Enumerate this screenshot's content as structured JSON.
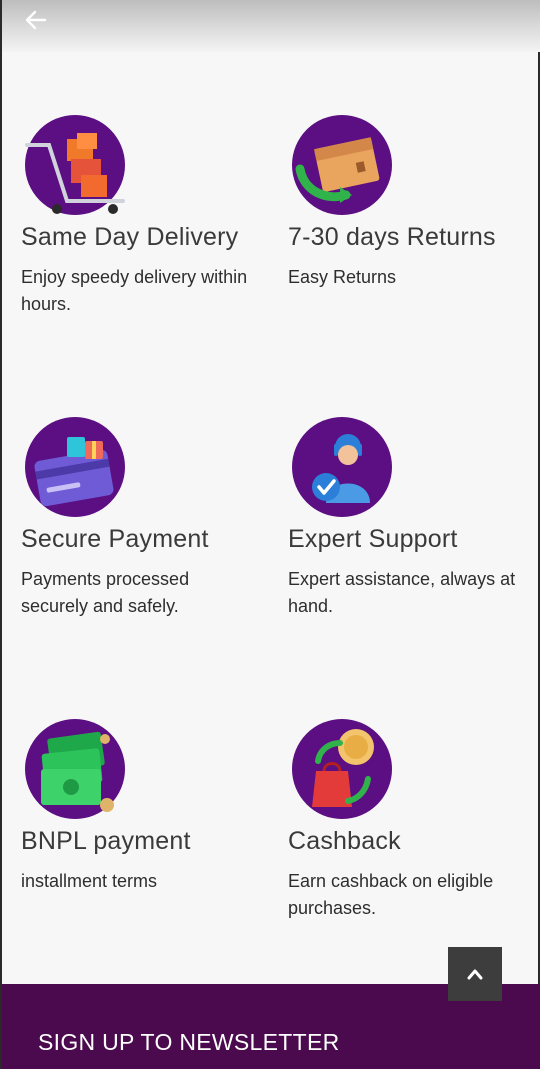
{
  "header": {
    "back_icon": "arrow-left-icon"
  },
  "features": [
    {
      "icon": "delivery-cart-icon",
      "title": "Same Day Delivery",
      "description": "Enjoy speedy delivery within hours."
    },
    {
      "icon": "returns-box-icon",
      "title": "7-30 days Returns",
      "description": "Easy Returns"
    },
    {
      "icon": "payment-card-icon",
      "title": "Secure Payment",
      "description": "Payments processed securely and safely."
    },
    {
      "icon": "support-agent-icon",
      "title": "Expert Support",
      "description": "Expert assistance, always at hand."
    },
    {
      "icon": "cash-notes-icon",
      "title": "BNPL payment",
      "description": "installment terms"
    },
    {
      "icon": "cashback-icon",
      "title": "Cashback",
      "description": "Earn cashback on eligible purchases."
    }
  ],
  "scroll_top": {
    "icon": "chevron-up-icon"
  },
  "newsletter": {
    "title": "SIGN UP TO NEWSLETTER"
  },
  "colors": {
    "icon_circle": "#5b0f82",
    "newsletter_bg": "#4a0a4d",
    "scroll_button_bg": "#3d3d3d"
  }
}
